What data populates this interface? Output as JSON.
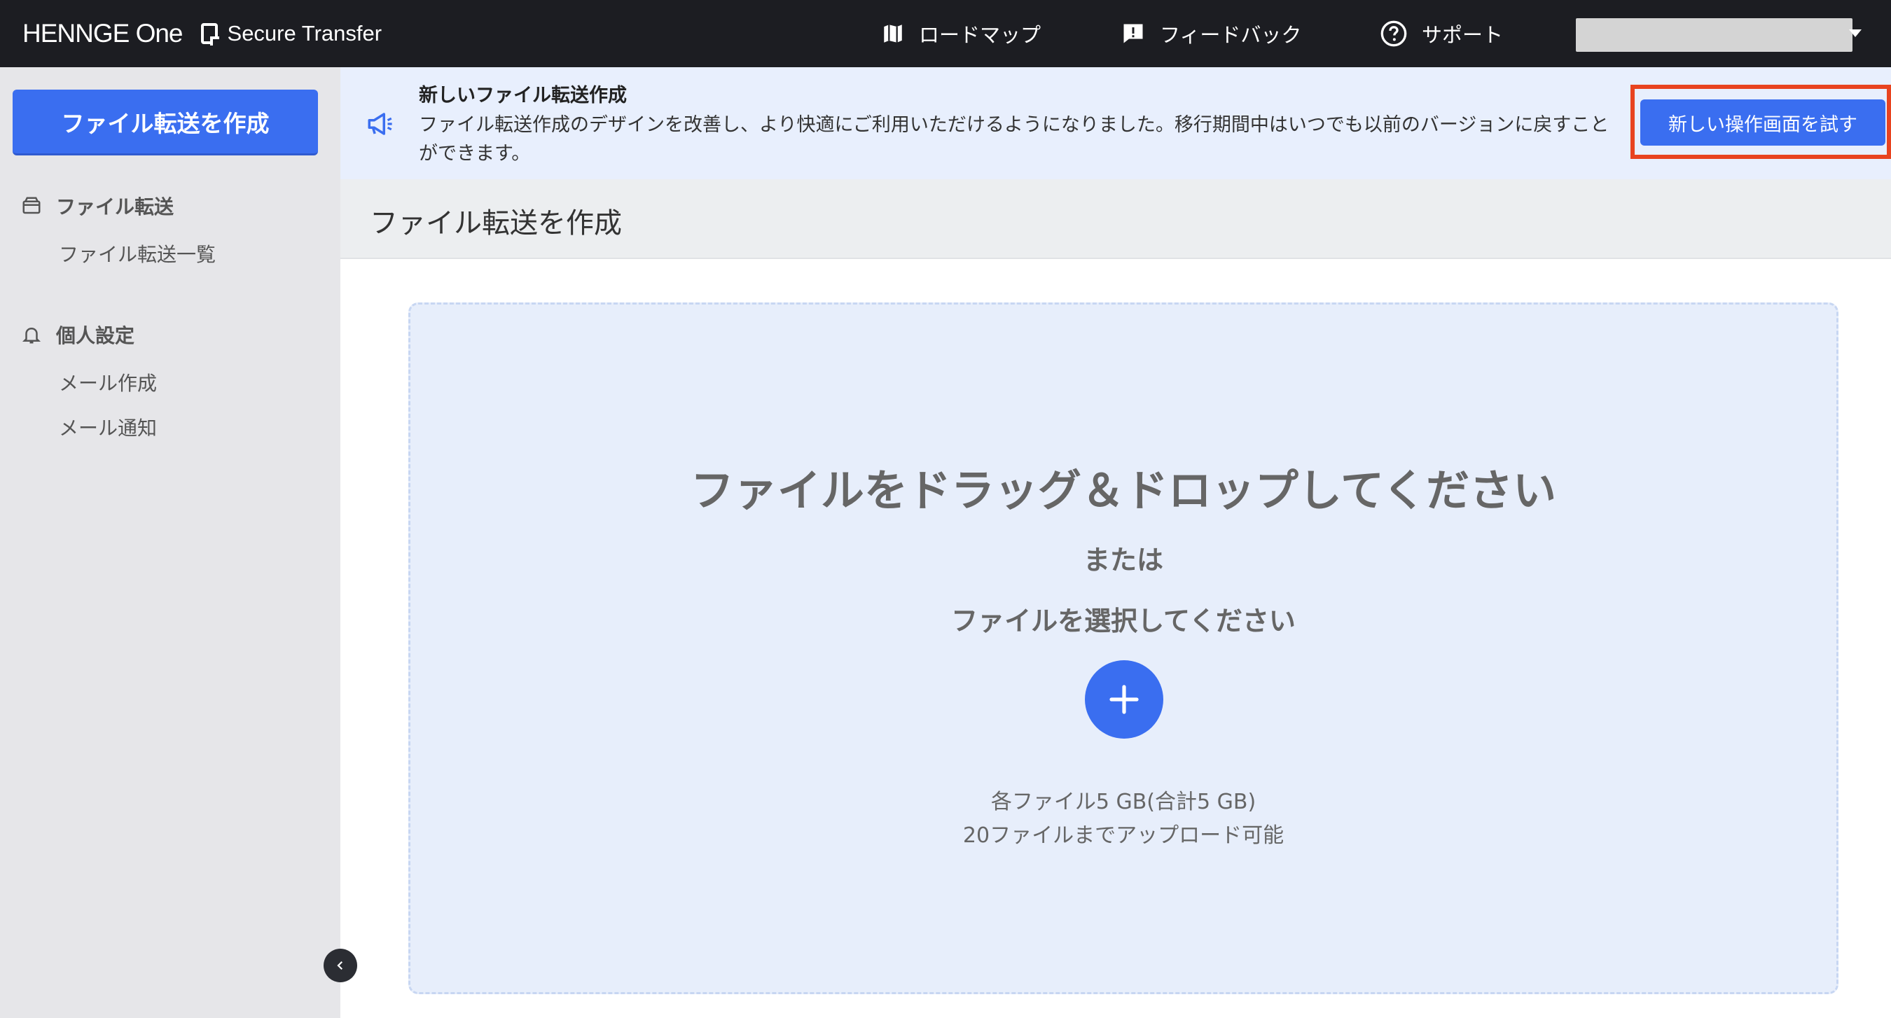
{
  "header": {
    "brand": "HENNGE One",
    "product": "Secure Transfer",
    "nav": {
      "roadmap": "ロードマップ",
      "feedback": "フィードバック",
      "support": "サポート"
    }
  },
  "sidebar": {
    "create_button": "ファイル転送を作成",
    "sections": [
      {
        "title": "ファイル転送",
        "icon": "box-icon",
        "items": [
          "ファイル転送一覧"
        ]
      },
      {
        "title": "個人設定",
        "icon": "bell-icon",
        "items": [
          "メール作成",
          "メール通知"
        ]
      }
    ]
  },
  "banner": {
    "title": "新しいファイル転送作成",
    "text": "ファイル転送作成のデザインを改善し、より快適にご利用いただけるようになりました。移行期間中はいつでも以前のバージョンに戻すことができます。",
    "button": "新しい操作画面を試す"
  },
  "page": {
    "title": "ファイル転送を作成"
  },
  "dropzone": {
    "main": "ファイルをドラッグ＆ドロップしてください",
    "or": "または",
    "select": "ファイルを選択してください",
    "limit_line1": "各ファイル5 GB(合計5 GB)",
    "limit_line2": "20ファイルまでアップロード可能"
  },
  "colors": {
    "header_bg": "#1c1d22",
    "accent": "#3a6ef0",
    "highlight": "#e8431f",
    "banner_bg": "#e8effd",
    "sidebar_bg": "#e6e6e9"
  }
}
